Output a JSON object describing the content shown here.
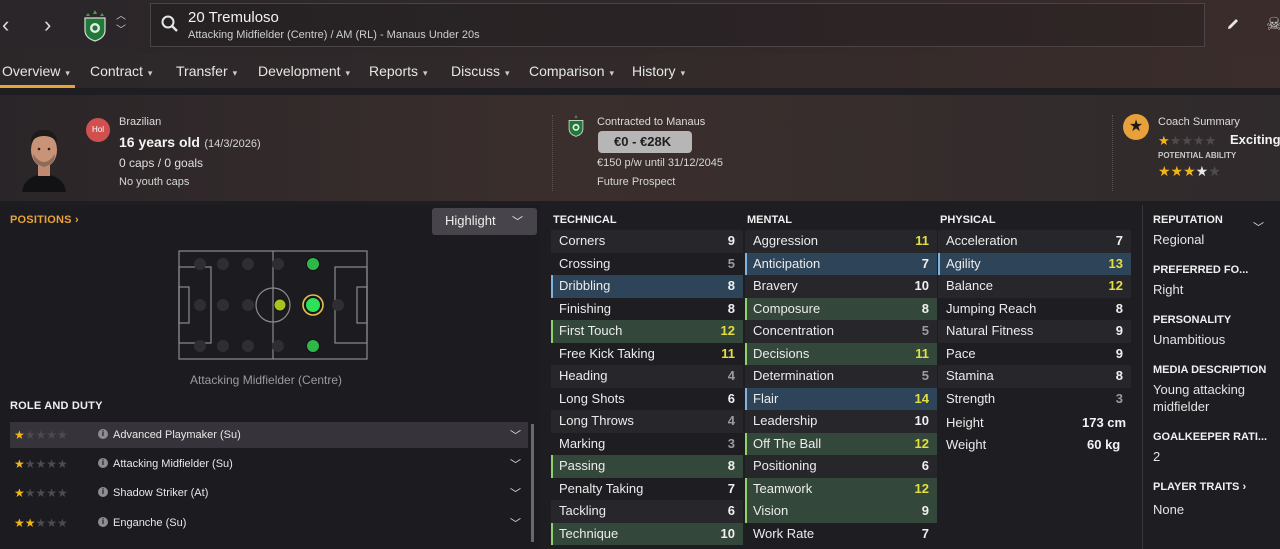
{
  "header": {
    "player_title": "20 Tremuloso",
    "player_subtitle": "Attacking Midfielder (Centre) / AM (RL) - Manaus Under 20s"
  },
  "tabs": [
    {
      "label": "Overview"
    },
    {
      "label": "Contract"
    },
    {
      "label": "Transfer"
    },
    {
      "label": "Development"
    },
    {
      "label": "Reports"
    },
    {
      "label": "Discuss"
    },
    {
      "label": "Comparison"
    },
    {
      "label": "History"
    }
  ],
  "profile": {
    "nationality": "Brazilian",
    "hol_badge": "Hol",
    "age": "16 years old",
    "dob": "(14/3/2026)",
    "caps": "0 caps / 0 goals",
    "youth_caps": "No youth caps"
  },
  "contract": {
    "contracted": "Contracted to Manaus",
    "value": "€0 - €28K",
    "wage": "€150 p/w until 31/12/2045",
    "status": "Future Prospect"
  },
  "coach": {
    "title": "Coach Summary",
    "current_stars": 1,
    "descriptor": "Exciting",
    "potential_label": "POTENTIAL ABILITY",
    "potential_stars": 3.5
  },
  "positions": {
    "title": "POSITIONS ›",
    "highlight_label": "Highlight",
    "caption": "Attacking Midfielder (Centre)"
  },
  "role_duty": {
    "title": "ROLE AND DUTY",
    "roles": [
      {
        "name": "Advanced Playmaker (Su)",
        "stars": 1
      },
      {
        "name": "Attacking Midfielder (Su)",
        "stars": 1
      },
      {
        "name": "Shadow Striker (At)",
        "stars": 1
      },
      {
        "name": "Enganche (Su)",
        "stars": 2
      }
    ]
  },
  "technical": {
    "title": "TECHNICAL",
    "rows": [
      {
        "name": "Corners",
        "value": "9"
      },
      {
        "name": "Crossing",
        "value": "5"
      },
      {
        "name": "Dribbling",
        "value": "8"
      },
      {
        "name": "Finishing",
        "value": "8"
      },
      {
        "name": "First Touch",
        "value": "12"
      },
      {
        "name": "Free Kick Taking",
        "value": "11"
      },
      {
        "name": "Heading",
        "value": "4"
      },
      {
        "name": "Long Shots",
        "value": "6"
      },
      {
        "name": "Long Throws",
        "value": "4"
      },
      {
        "name": "Marking",
        "value": "3"
      },
      {
        "name": "Passing",
        "value": "8"
      },
      {
        "name": "Penalty Taking",
        "value": "7"
      },
      {
        "name": "Tackling",
        "value": "6"
      },
      {
        "name": "Technique",
        "value": "10"
      }
    ]
  },
  "mental": {
    "title": "MENTAL",
    "rows": [
      {
        "name": "Aggression",
        "value": "11"
      },
      {
        "name": "Anticipation",
        "value": "7"
      },
      {
        "name": "Bravery",
        "value": "10"
      },
      {
        "name": "Composure",
        "value": "8"
      },
      {
        "name": "Concentration",
        "value": "5"
      },
      {
        "name": "Decisions",
        "value": "11"
      },
      {
        "name": "Determination",
        "value": "5"
      },
      {
        "name": "Flair",
        "value": "14"
      },
      {
        "name": "Leadership",
        "value": "10"
      },
      {
        "name": "Off The Ball",
        "value": "12"
      },
      {
        "name": "Positioning",
        "value": "6"
      },
      {
        "name": "Teamwork",
        "value": "12"
      },
      {
        "name": "Vision",
        "value": "9"
      },
      {
        "name": "Work Rate",
        "value": "7"
      }
    ]
  },
  "physical": {
    "title": "PHYSICAL",
    "rows": [
      {
        "name": "Acceleration",
        "value": "7"
      },
      {
        "name": "Agility",
        "value": "13"
      },
      {
        "name": "Balance",
        "value": "12"
      },
      {
        "name": "Jumping Reach",
        "value": "8"
      },
      {
        "name": "Natural Fitness",
        "value": "9"
      },
      {
        "name": "Pace",
        "value": "9"
      },
      {
        "name": "Stamina",
        "value": "8"
      },
      {
        "name": "Strength",
        "value": "3"
      }
    ],
    "height_label": "Height",
    "height_value": "173 cm",
    "weight_label": "Weight",
    "weight_value": "60 kg"
  },
  "sidebar": {
    "reputation_head": "REPUTATION",
    "reputation": "Regional",
    "foot_head": "PREFERRED FO...",
    "foot": "Right",
    "personality_head": "PERSONALITY",
    "personality": "Unambitious",
    "media_head": "MEDIA DESCRIPTION",
    "media_line1": "Young attacking",
    "media_line2": "midfielder",
    "gk_head": "GOALKEEPER RATI...",
    "gk": "2",
    "traits_head": "PLAYER TRAITS ›",
    "traits": "None"
  }
}
